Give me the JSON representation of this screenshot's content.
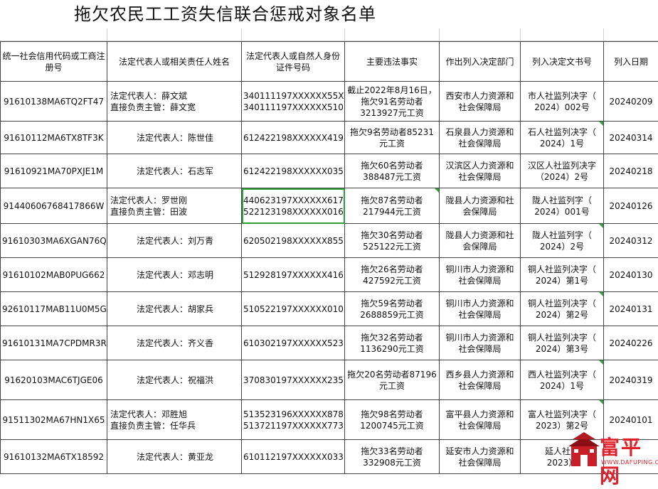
{
  "title": "拖欠农民工工资失信联合惩戒对象名单",
  "headers": {
    "code": "统一社会信用代码或工商注册号",
    "name": "法定代表人或相关责任人姓名",
    "idno": "法定代表人或自然人身份证件号码",
    "facts": "主要违法事实",
    "dept": "作出列入决定部门",
    "docno": "列入决定文书号",
    "date": "列入日期"
  },
  "rows": [
    {
      "code": "91610138MA6TQ2FT47",
      "names": [
        "法定代表人：薛文斌",
        "直接负责主管：薛文宽"
      ],
      "ids": [
        "340111197XXXXXX55X",
        "340111197XXXXXX510"
      ],
      "facts": [
        "截止2022年8月16日，",
        "拖欠91名劳动者",
        "3213927元工资"
      ],
      "dept": [
        "西安市人力资源和",
        "社会保障局"
      ],
      "docno": [
        "市人社监列决字（",
        "2024）002号"
      ],
      "date": "20240209"
    },
    {
      "code": "91610112MA6TX8TF3K",
      "names": [
        "法定代表人：陈世佳"
      ],
      "ids": [
        "612422198XXXXXX419"
      ],
      "facts": [
        "拖欠9名劳动者85231",
        "元工资"
      ],
      "dept": [
        "石泉县人力资源和",
        "社会保障局"
      ],
      "docno": [
        "石人社监列决字（",
        "2024）1号"
      ],
      "date": "20240314"
    },
    {
      "code": "91610921MA70PXJE1M",
      "names": [
        "法定代表人：石志军"
      ],
      "ids": [
        "612422198XXXXXX035"
      ],
      "facts": [
        "拖欠60名劳动者",
        "388487元工资"
      ],
      "dept": [
        "汉滨区人力资源和",
        "社会保障局"
      ],
      "docno": [
        "汉区人社监列决字",
        "（2024）2号"
      ],
      "date": "20240218"
    },
    {
      "code": "91440606768417866W",
      "names": [
        "法定代表人：罗世刚",
        "直接负责主管：田波"
      ],
      "ids": [
        "440623197XXXXXX617",
        "522123198XXXXXX016"
      ],
      "facts": [
        "拖欠87名劳动者",
        "217944元工资"
      ],
      "dept": [
        "陇县人力资源和社",
        "会保障局"
      ],
      "docno": [
        "陇人社监列字（",
        "2024）001号"
      ],
      "date": "20240126"
    },
    {
      "code": "91610303MA6XGAN76Q",
      "names": [
        "法定代表人：刘万青"
      ],
      "ids": [
        "620502198XXXXXX855"
      ],
      "facts": [
        "拖欠30名劳动者",
        "525122元工资"
      ],
      "dept": [
        "陇县人力资源和社",
        "会保障局"
      ],
      "docno": [
        "陇人社监列字（",
        "2024）2号"
      ],
      "date": "20240312"
    },
    {
      "code": "91610102MAB0PUG662",
      "names": [
        "法定代表人：邓志明"
      ],
      "ids": [
        "512928197XXXXXX416"
      ],
      "facts": [
        "拖欠26名劳动者",
        "427592元工资"
      ],
      "dept": [
        "铜川市人力资源和",
        "社会保障局"
      ],
      "docno": [
        "铜人社监列决字（",
        "2024）第1号"
      ],
      "date": "20240130"
    },
    {
      "code": "92610117MAB11U0M5G",
      "names": [
        "法定代表人：胡家兵"
      ],
      "ids": [
        "510522197XXXXXX010"
      ],
      "facts": [
        "拖欠59名劳动者",
        "2688859元工资"
      ],
      "dept": [
        "铜川市人力资源和",
        "社会保障局"
      ],
      "docno": [
        "铜人社监列决字（",
        "2024）第2号"
      ],
      "date": "20240131"
    },
    {
      "code": "91610131MA7CPDMR3R",
      "names": [
        "法定代表人：齐义香"
      ],
      "ids": [
        "610302197XXXXXX523"
      ],
      "facts": [
        "拖欠32名劳动者",
        "1136290元工资"
      ],
      "dept": [
        "铜川市人力资源和",
        "社会保障局"
      ],
      "docno": [
        "铜人社监列决字（",
        "2024）第3号"
      ],
      "date": "20240226"
    },
    {
      "code": "91620103MAC6TJGE06",
      "names": [
        "法定代表人：祝福洪"
      ],
      "ids": [
        "370830197XXXXXX235"
      ],
      "facts": [
        "拖欠20名劳动者87196",
        "元工资"
      ],
      "dept": [
        "西乡县人力资源和",
        "社会保障局"
      ],
      "docno": [
        "西人社监列决字（",
        "2024）1号"
      ],
      "date": "20240319"
    },
    {
      "code": "91511302MA67HN1X65",
      "names": [
        "法定代表人：邓胜旭",
        "直接负责主管：任华兵"
      ],
      "ids": [
        "513523196XXXXXX878",
        "513721197XXXXXX773"
      ],
      "facts": [
        "拖欠98名劳动者",
        "1200745元工资"
      ],
      "dept": [
        "富平县人力资源和",
        "社会保障局"
      ],
      "docno": [
        "富人社监列决字（",
        "2023）第2号"
      ],
      "date": "20240101"
    },
    {
      "code": "91610132MA6TX18592",
      "names": [
        "法定代表人：黄亚龙"
      ],
      "ids": [
        "610112197XXXXXX033"
      ],
      "facts": [
        "拖欠33名劳动者",
        "332908元工资"
      ],
      "dept": [
        "延安市人力资源和",
        "社会保障局"
      ],
      "docno": [
        "延人社监",
        "2023）"
      ],
      "date": ""
    }
  ],
  "watermark": {
    "text": "富平网",
    "sub": "WWW.DAFUPING.CN"
  }
}
